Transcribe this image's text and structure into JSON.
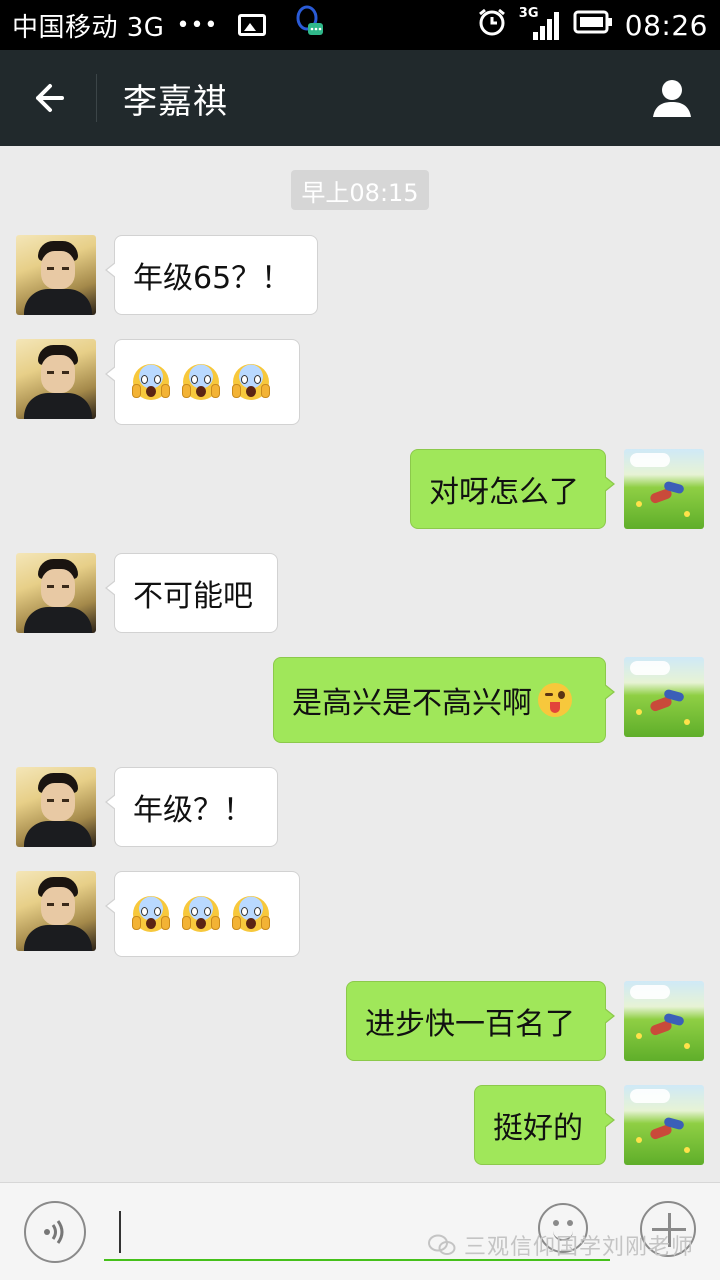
{
  "status_bar": {
    "carrier": "中国移动 3G",
    "dots": "•••",
    "network_label": "3G",
    "time": "08:26",
    "icons": [
      "gallery-icon",
      "qq-notification-icon",
      "alarm-icon",
      "signal-icon",
      "battery-icon"
    ]
  },
  "header": {
    "title": "李嘉祺",
    "back_icon": "arrow-left-icon",
    "profile_icon": "person-icon"
  },
  "chat": {
    "timestamp": "早上08:15",
    "messages": [
      {
        "side": "left",
        "text": "年级65？！",
        "avatar": "boy-photo"
      },
      {
        "side": "left",
        "emoji": "scream-emoji",
        "count": 3,
        "avatar": "boy-photo"
      },
      {
        "side": "right",
        "text": "对呀怎么了",
        "avatar": "meadow-illustration"
      },
      {
        "side": "left",
        "text": "不可能吧",
        "avatar": "boy-photo"
      },
      {
        "side": "right",
        "text": "是高兴是不高兴啊",
        "emoji_after": "wink-tongue-emoji",
        "avatar": "meadow-illustration"
      },
      {
        "side": "left",
        "text": "年级？！",
        "avatar": "boy-photo"
      },
      {
        "side": "left",
        "emoji": "scream-emoji",
        "count": 3,
        "avatar": "boy-photo"
      },
      {
        "side": "right",
        "text": "进步快一百名了",
        "avatar": "meadow-illustration"
      },
      {
        "side": "right",
        "text": "挺好的",
        "avatar": "meadow-illustration"
      }
    ]
  },
  "input_bar": {
    "value": "",
    "voice_icon": "voice-icon",
    "emoji_icon": "smiley-icon",
    "plus_icon": "plus-icon"
  },
  "watermark": "三观信仰国学刘刚老师",
  "colors": {
    "status_bar_bg": "#000000",
    "title_bar_bg": "#21292c",
    "chat_bg": "#ebebeb",
    "bubble_self": "#a0e75a",
    "bubble_other": "#ffffff",
    "input_underline": "#45c01a"
  }
}
